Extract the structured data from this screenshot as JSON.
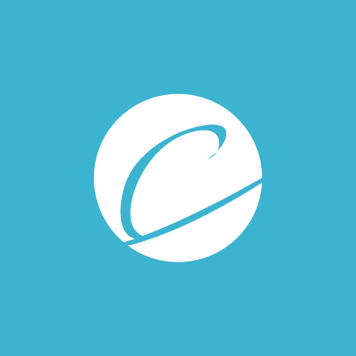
{
  "app": {
    "icon": "script-c-logo-icon",
    "colors": {
      "background": "#3db4cf",
      "circle": "#ffffff",
      "mark": "#3db4cf"
    }
  }
}
